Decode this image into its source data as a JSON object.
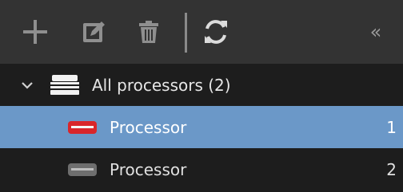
{
  "toolbar": {
    "buttons": [
      {
        "icon": "plus-icon"
      },
      {
        "icon": "edit-icon"
      },
      {
        "icon": "trash-icon"
      },
      {
        "icon": "refresh-icon"
      }
    ],
    "collapse_label": "«"
  },
  "tree": {
    "group": {
      "label": "All processors (2)",
      "icon": "server-stack-icon",
      "expanded": true
    },
    "items": [
      {
        "label": "Processor",
        "index": "1",
        "icon": "processor-icon",
        "icon_color": "#d9262b",
        "selected": true
      },
      {
        "label": "Processor",
        "index": "2",
        "icon": "processor-icon",
        "icon_color": "#6e6e6e",
        "selected": false
      }
    ]
  },
  "colors": {
    "toolbar_bg": "#333333",
    "selected_bg": "#6b98c8",
    "list_bg": "#1d1d1d"
  }
}
